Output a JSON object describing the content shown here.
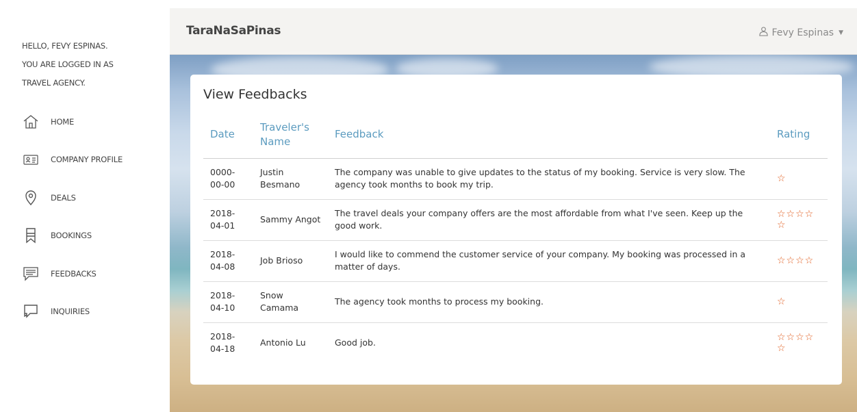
{
  "sidebar": {
    "greeting": [
      "HELLO, FEVY ESPINAS.",
      "YOU ARE LOGGED IN AS",
      "TRAVEL AGENCY."
    ],
    "items": [
      {
        "label": "HOME",
        "icon": "home-icon"
      },
      {
        "label": "COMPANY PROFILE",
        "icon": "id-card-icon"
      },
      {
        "label": "DEALS",
        "icon": "map-pin-icon"
      },
      {
        "label": "BOOKINGS",
        "icon": "bookmark-icon"
      },
      {
        "label": "FEEDBACKS",
        "icon": "chat-bubble-icon"
      },
      {
        "label": "INQUIRIES",
        "icon": "inquiry-bubble-icon"
      }
    ]
  },
  "header": {
    "brand": "TaraNaSaPinas",
    "user": "Fevy Espinas"
  },
  "main": {
    "title": "View Feedbacks",
    "columns": [
      "Date",
      "Traveler's Name",
      "Feedback",
      "Rating"
    ],
    "rows": [
      {
        "date": "0000-00-00",
        "name": "Justin Besmano",
        "feedback": "The company was unable to give updates to the status of my booking. Service is very slow. The agency took months to book my trip.",
        "rating": 1
      },
      {
        "date": "2018-04-01",
        "name": "Sammy Angot",
        "feedback": "The travel deals your company offers are the most affordable from what I've seen. Keep up the good work.",
        "rating": 5
      },
      {
        "date": "2018-04-08",
        "name": "Job Brioso",
        "feedback": "I would like to commend the customer service of your company. My booking was processed in a matter of days.",
        "rating": 4
      },
      {
        "date": "2018-04-10",
        "name": "Snow Camama",
        "feedback": "The agency took months to process my booking.",
        "rating": 1
      },
      {
        "date": "2018-04-18",
        "name": "Antonio Lu",
        "feedback": "Good job.",
        "rating": 5
      }
    ]
  },
  "colors": {
    "accent": "#5b9bbf",
    "star": "#e05a1b",
    "topbar": "#f4f3f1"
  }
}
